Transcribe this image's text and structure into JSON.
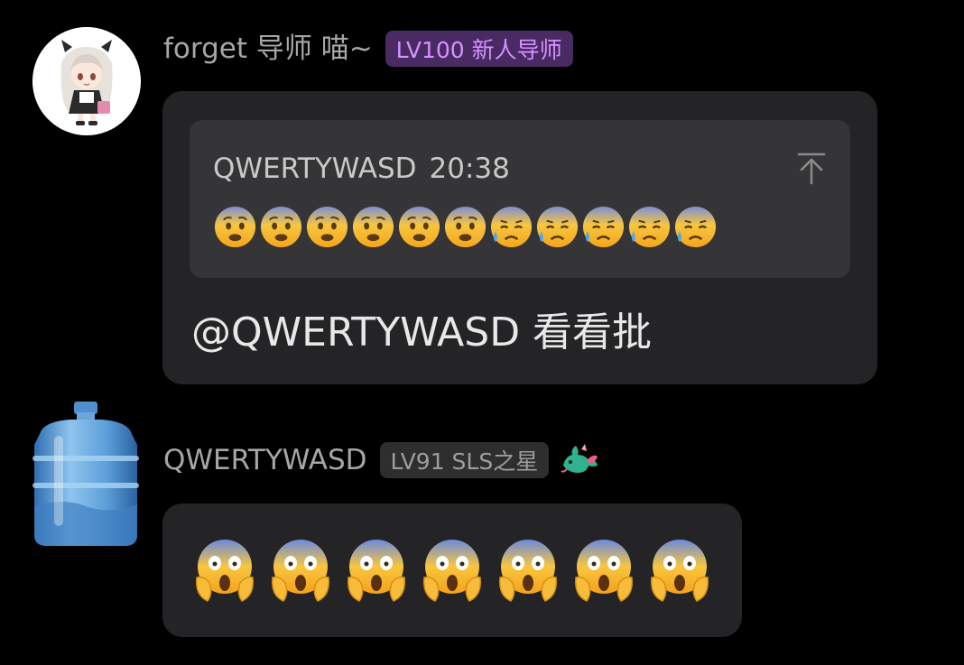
{
  "messages": [
    {
      "sender": "forget 导师 喵~",
      "badge": "LV100 新人导师",
      "avatar_icon": "anime-girl-avatar",
      "quote": {
        "sender": "QWERTYWASD",
        "time": "20:38",
        "emojis": [
          "fearful-face",
          "fearful-face",
          "fearful-face",
          "fearful-face",
          "fearful-face",
          "fearful-face",
          "anxious-face-with-sweat",
          "anxious-face-with-sweat",
          "anxious-face-with-sweat",
          "anxious-face-with-sweat",
          "anxious-face-with-sweat"
        ]
      },
      "text": "@QWERTYWASD 看看批"
    },
    {
      "sender": "QWERTYWASD",
      "badge": "LV91 SLS之星",
      "avatar_icon": "water-jug-avatar",
      "badge_icon": "dragon-icon",
      "emojis": [
        "face-screaming-in-fear",
        "face-screaming-in-fear",
        "face-screaming-in-fear",
        "face-screaming-in-fear",
        "face-screaming-in-fear",
        "face-screaming-in-fear",
        "face-screaming-in-fear"
      ]
    }
  ],
  "colors": {
    "background": "#000000",
    "bubble": "#242426",
    "quote": "#353537",
    "purple_badge_bg": "#4a2a63",
    "purple_badge_text": "#d592ff",
    "gray_badge_bg": "#2e2e2e"
  }
}
